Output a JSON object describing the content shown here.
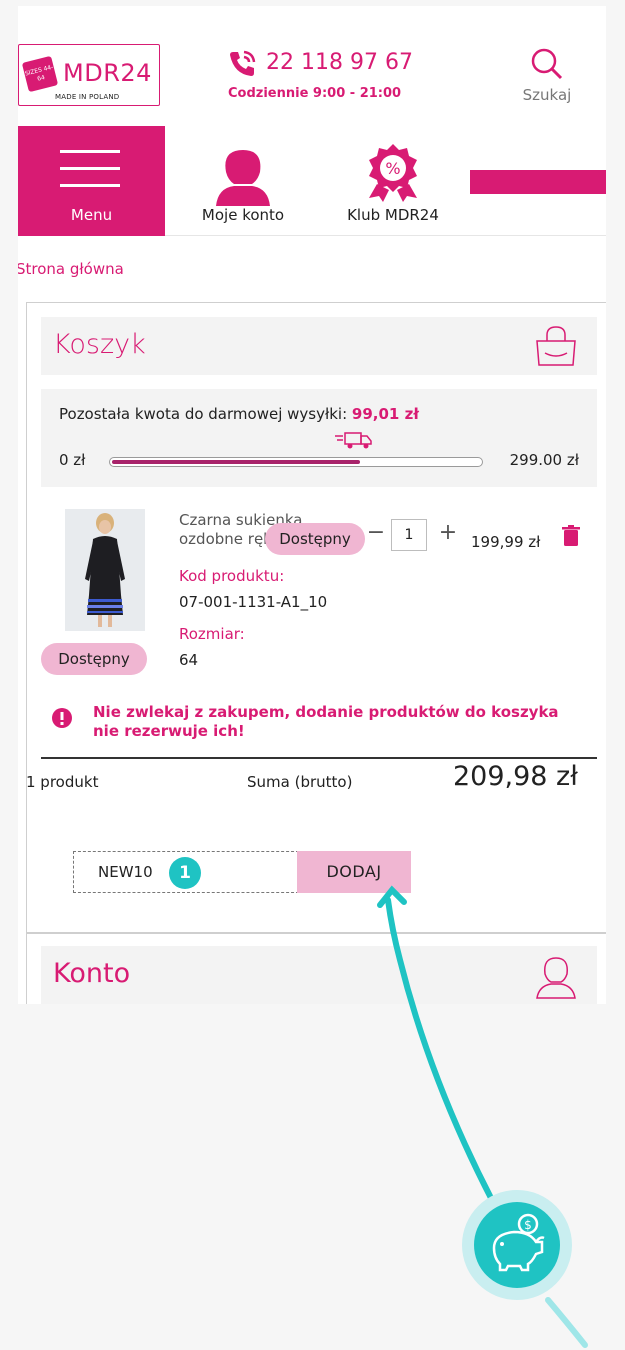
{
  "header": {
    "logo_brand": "MDR24",
    "logo_sub": "MADE IN POLAND",
    "logo_tag": "SIZES 44-64",
    "phone": "22 118 97 67",
    "hours": "Codziennie 9:00 - 21:00",
    "search_label": "Szukaj"
  },
  "nav": {
    "menu": "Menu",
    "account": "Moje konto",
    "club": "Klub MDR24"
  },
  "breadcrumb": "Strona główna",
  "cart": {
    "title": "Koszyk",
    "shipping_text": "Pozostała kwota do darmowej wysyłki:",
    "shipping_remaining": "99,01 zł",
    "shipping_min": "0 zł",
    "shipping_max": "299.00 zł",
    "shipping_progress_fraction": 0.67,
    "product": {
      "name": "Czarna sukienka ozdobne rękawy",
      "availability": "Dostępny",
      "availability_overlay": "Dostępny",
      "quantity": "1",
      "minus": "−",
      "plus": "+",
      "price": "199,99 zł",
      "code_label": "Kod produktu:",
      "code": "07-001-1131-A1_10",
      "size_label": "Rozmiar:",
      "size": "64"
    },
    "warning": "Nie zwlekaj z zakupem, dodanie produktów do koszyka nie rezerwuje ich!",
    "count": "1 produkt",
    "sum_label": "Suma (brutto)",
    "total": "209,98 zł",
    "coupon_value": "NEW10",
    "coupon_button": "DODAJ",
    "step": "1"
  },
  "account_section": {
    "title": "Konto"
  },
  "colors": {
    "brand": "#d81b73",
    "badge": "#f0b6d2",
    "accent": "#1fc3c3"
  }
}
